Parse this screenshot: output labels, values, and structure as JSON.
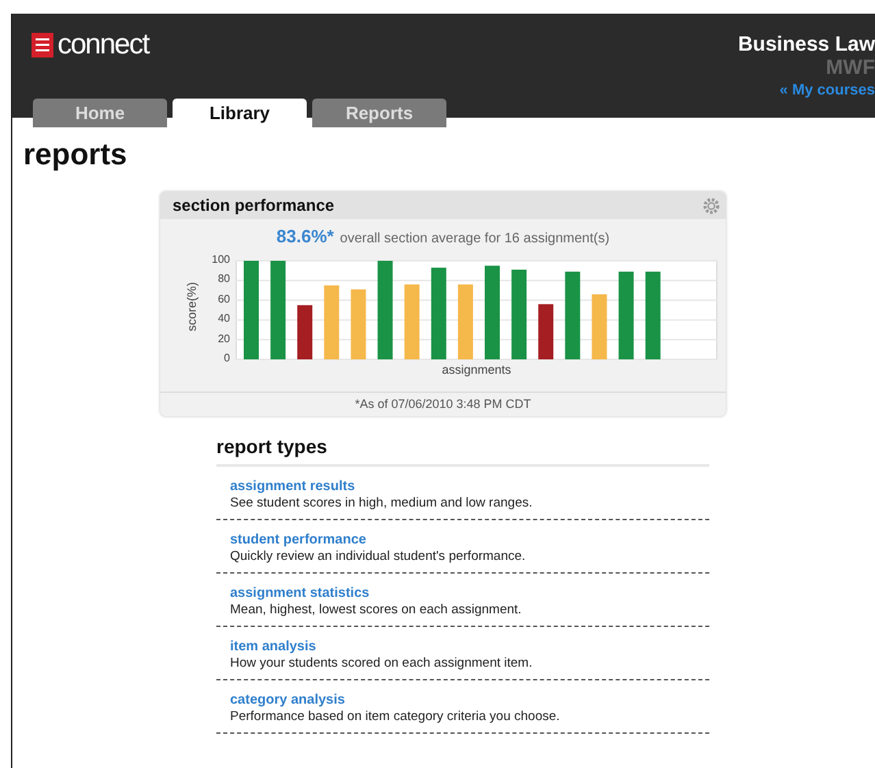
{
  "header": {
    "logo_text": "connect",
    "course_title": "Business Law",
    "course_section": "MWF",
    "my_courses_link": "« My courses"
  },
  "tabs": [
    {
      "label": "Home",
      "selected": false
    },
    {
      "label": "Library",
      "selected": true
    },
    {
      "label": "Reports",
      "selected": false
    }
  ],
  "page_title": "reports",
  "section_performance": {
    "title": "section performance",
    "average": "83.6%*",
    "average_caption": "overall section average for 16 assignment(s)",
    "footnote": "*As of 07/06/2010 3:48 PM CDT",
    "chart_data": {
      "type": "bar",
      "xlabel": "assignments",
      "ylabel": "score(%)",
      "ylim": [
        0,
        100
      ],
      "yticks": [
        0,
        20,
        40,
        60,
        80,
        100
      ],
      "grid": true,
      "stacked": true,
      "series": [
        {
          "color": "#1a9346",
          "values": [
            100,
            100,
            null,
            null,
            null,
            100,
            null,
            93,
            null,
            95,
            91,
            null,
            89,
            null,
            89,
            89
          ]
        },
        {
          "color": "#f5b84b",
          "values": [
            null,
            null,
            null,
            75,
            71,
            null,
            76,
            null,
            76,
            null,
            null,
            null,
            null,
            66,
            null,
            null
          ]
        },
        {
          "color": "#a51e22",
          "values": [
            null,
            null,
            55,
            null,
            null,
            null,
            null,
            null,
            null,
            null,
            null,
            56,
            null,
            null,
            null,
            null
          ]
        }
      ]
    }
  },
  "report_types": {
    "title": "report types",
    "items": [
      {
        "link": "assignment results",
        "description": "See student scores in high, medium and low ranges."
      },
      {
        "link": "student performance",
        "description": "Quickly review an individual student's performance."
      },
      {
        "link": "assignment statistics",
        "description": "Mean, highest, lowest scores on each assignment."
      },
      {
        "link": "item analysis",
        "description": "How your students scored on each assignment item."
      },
      {
        "link": "category analysis",
        "description": "Performance based on item category criteria you choose."
      }
    ]
  }
}
